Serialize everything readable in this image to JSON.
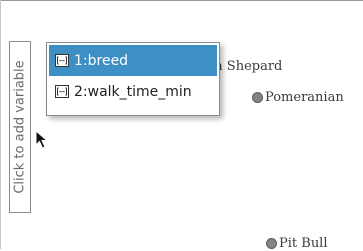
{
  "axis": {
    "add_variable_label": "Click to add variable"
  },
  "menu": {
    "items": [
      {
        "label": "1:breed",
        "icon": "variable-icon",
        "selected": true
      },
      {
        "label": "2:walk_time_min",
        "icon": "variable-icon",
        "selected": false
      }
    ]
  },
  "plot": {
    "points": [
      {
        "label": "rman Shepard"
      },
      {
        "label": "Pomeranian"
      },
      {
        "label": "Pit Bull"
      }
    ]
  },
  "colors": {
    "highlight": "#3d8fc4",
    "dot_fill": "#858585",
    "axis_text": "#6a6a6a"
  }
}
